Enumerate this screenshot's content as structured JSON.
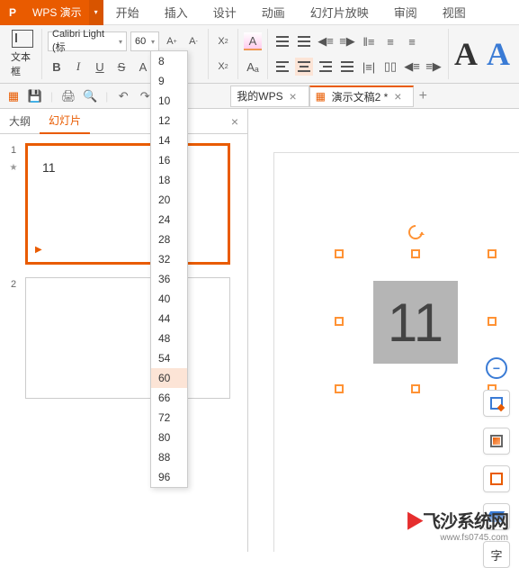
{
  "app": {
    "logo_text": "P",
    "title": "WPS 演示",
    "caret": "▾"
  },
  "menus": [
    "开始",
    "插入",
    "设计",
    "动画",
    "幻灯片放映",
    "审阅",
    "视图"
  ],
  "ribbon": {
    "textbox_label": "文本框",
    "font_name": "Calibri Light (标",
    "font_size": "60",
    "increase": "A⁺",
    "decrease": "A⁻",
    "bold": "B",
    "italic": "I",
    "underline": "U",
    "strike": "S",
    "fontA": "A",
    "colorA": "A",
    "sup": "X²",
    "sub": "X₂",
    "highlight": "A",
    "clear": "Aₐ"
  },
  "doc_tabs": {
    "tab1": "我的WPS",
    "tab2": "演示文稿2 *",
    "close": "×",
    "add": "+"
  },
  "sidebar": {
    "tab_outline": "大纲",
    "tab_slides": "幻灯片",
    "close": "×"
  },
  "thumbs": [
    {
      "num": "1",
      "text": "11",
      "selected": true,
      "star": true
    },
    {
      "num": "2",
      "text": "",
      "selected": false,
      "star": false
    }
  ],
  "slide": {
    "text": "11"
  },
  "side_tools": {
    "delete": "−"
  },
  "size_options": [
    "8",
    "9",
    "10",
    "12",
    "14",
    "16",
    "18",
    "20",
    "24",
    "28",
    "32",
    "36",
    "40",
    "44",
    "48",
    "54",
    "60",
    "66",
    "72",
    "80",
    "88",
    "96"
  ],
  "size_highlighted": "60",
  "watermark": {
    "brand": "飞沙系统网",
    "url": "www.fs0745.com"
  },
  "colors": {
    "accent": "#e95b00",
    "blue": "#3a7bd5"
  }
}
